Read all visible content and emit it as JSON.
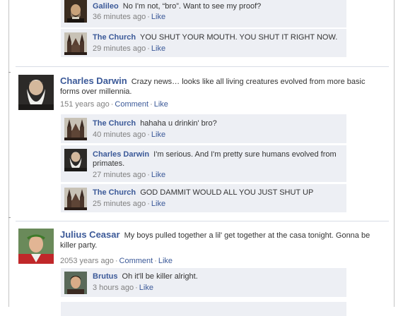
{
  "colors": {
    "link": "#3b5998",
    "comment_bg": "#edeff4",
    "meta": "#808080"
  },
  "thread1": {
    "replies": [
      {
        "author": "Galileo",
        "text": "No I'm not, “bro”.  Want to see my proof?",
        "time": "36 minutes ago",
        "like": "Like",
        "avatar": "galileo-portrait-icon"
      },
      {
        "author": "The Church",
        "text": "YOU SHUT YOUR MOUTH.  YOU SHUT IT RIGHT NOW.",
        "time": "29 minutes ago",
        "like": "Like",
        "avatar": "church-building-icon"
      }
    ]
  },
  "post_darwin": {
    "author": "Charles Darwin",
    "text": "Crazy news… looks like all living creatures evolved from more basic forms over millennia.",
    "time": "151 years ago",
    "comment": "Comment",
    "like": "Like",
    "avatar": "darwin-portrait-icon",
    "replies": [
      {
        "author": "The Church",
        "text": "hahaha u drinkin' bro?",
        "time": "40 minutes ago",
        "like": "Like",
        "avatar": "church-building-icon"
      },
      {
        "author": "Charles Darwin",
        "text": "I'm serious.  And I'm pretty sure humans evolved from primates.",
        "time": "27 minutes ago",
        "like": "Like",
        "avatar": "darwin-portrait-icon"
      },
      {
        "author": "The Church",
        "text": "GOD DAMMIT WOULD ALL YOU JUST SHUT UP",
        "time": "25 minutes ago",
        "like": "Like",
        "avatar": "church-building-icon"
      }
    ]
  },
  "post_caesar": {
    "author": "Julius Ceasar",
    "text": "My boys pulled together a lil' get together at the casa tonight. Gonna be killer party.",
    "time": "2053 years ago",
    "comment": "Comment",
    "like": "Like",
    "avatar": "caesar-portrait-icon",
    "replies": [
      {
        "author": "Brutus",
        "text": "Oh it'll be killer alright.",
        "time": "3 hours ago",
        "like": "Like",
        "avatar": "brutus-portrait-icon"
      }
    ]
  }
}
